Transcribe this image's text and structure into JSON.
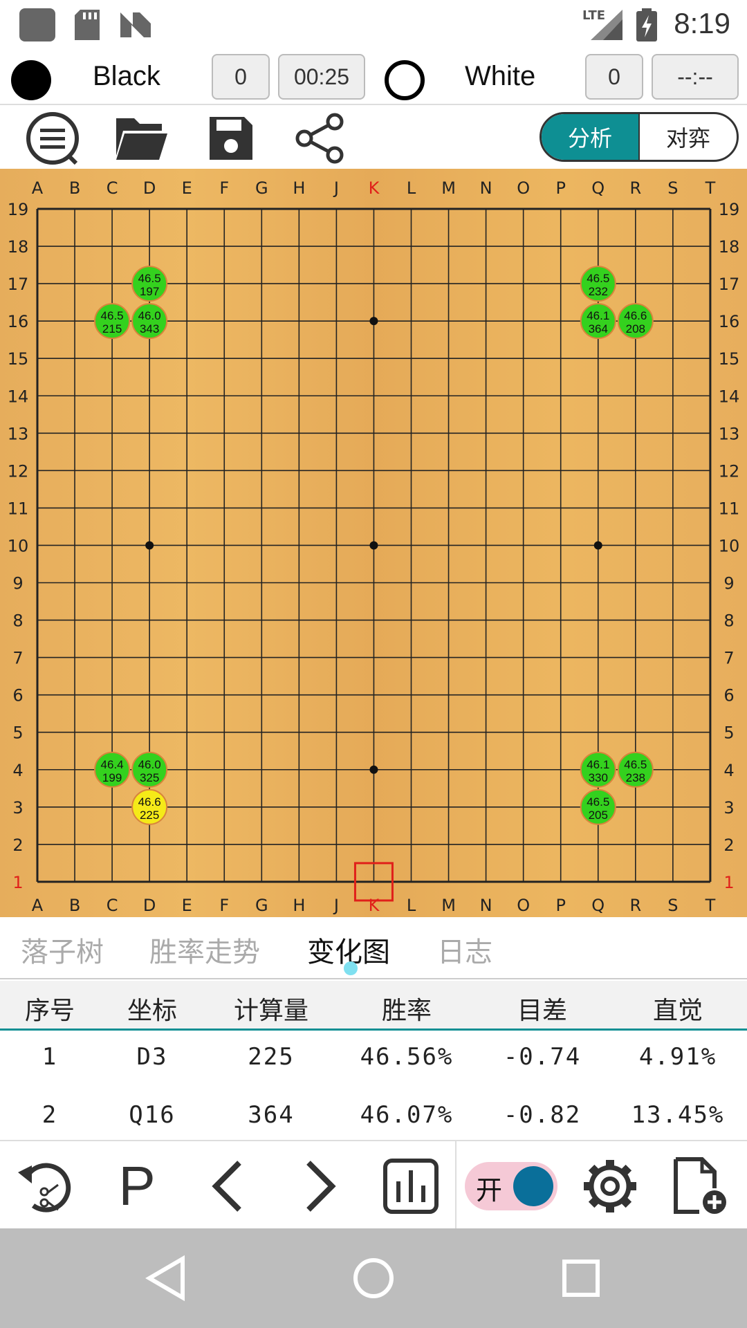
{
  "status_bar": {
    "time": "8:19",
    "network": "LTE",
    "icons": [
      "app-icon",
      "sdcard-icon",
      "n-icon",
      "signal-icon",
      "battery-charging-icon"
    ]
  },
  "players": {
    "black": {
      "name": "Black",
      "captures": "0",
      "time": "00:25"
    },
    "white": {
      "name": "White",
      "captures": "0",
      "time": "--:--"
    }
  },
  "toolbar": {
    "icons": [
      "menu-icon",
      "folder-open-icon",
      "save-icon",
      "share-icon"
    ],
    "mode_analyze": "分析",
    "mode_play": "对弈",
    "active_mode": "analyze"
  },
  "board": {
    "columns": [
      "A",
      "B",
      "C",
      "D",
      "E",
      "F",
      "G",
      "H",
      "J",
      "K",
      "L",
      "M",
      "N",
      "O",
      "P",
      "Q",
      "R",
      "S",
      "T"
    ],
    "rows": [
      "19",
      "18",
      "17",
      "16",
      "15",
      "14",
      "13",
      "12",
      "11",
      "10",
      "9",
      "8",
      "7",
      "6",
      "5",
      "4",
      "3",
      "2",
      "1"
    ],
    "highlight_column": "K",
    "highlight_row": "1",
    "last_move_marker": "K1",
    "highlight_color": "#e0201a",
    "star_points": [
      "D16",
      "K16",
      "Q16",
      "D10",
      "K10",
      "Q10",
      "D4",
      "K4",
      "Q4"
    ],
    "candidates": [
      {
        "coord": "D17",
        "winrate": "46.5",
        "visits": "197",
        "best": false
      },
      {
        "coord": "C16",
        "winrate": "46.5",
        "visits": "215",
        "best": false
      },
      {
        "coord": "D16",
        "winrate": "46.0",
        "visits": "343",
        "best": false
      },
      {
        "coord": "Q17",
        "winrate": "46.5",
        "visits": "232",
        "best": false
      },
      {
        "coord": "Q16",
        "winrate": "46.1",
        "visits": "364",
        "best": false
      },
      {
        "coord": "R16",
        "winrate": "46.6",
        "visits": "208",
        "best": false
      },
      {
        "coord": "C4",
        "winrate": "46.4",
        "visits": "199",
        "best": false
      },
      {
        "coord": "D4",
        "winrate": "46.0",
        "visits": "325",
        "best": false
      },
      {
        "coord": "D3",
        "winrate": "46.6",
        "visits": "225",
        "best": true
      },
      {
        "coord": "Q4",
        "winrate": "46.1",
        "visits": "330",
        "best": false
      },
      {
        "coord": "R4",
        "winrate": "46.5",
        "visits": "238",
        "best": false
      },
      {
        "coord": "Q3",
        "winrate": "46.5",
        "visits": "205",
        "best": false
      }
    ]
  },
  "tabs": [
    {
      "label": "落子树",
      "active": false
    },
    {
      "label": "胜率走势",
      "active": false
    },
    {
      "label": "变化图",
      "active": true
    },
    {
      "label": "日志",
      "active": false
    }
  ],
  "table": {
    "headers": [
      "序号",
      "坐标",
      "计算量",
      "胜率",
      "目差",
      "直觉"
    ],
    "rows": [
      [
        "1",
        "D3",
        "225",
        "46.56%",
        "-0.74",
        "4.91%"
      ],
      [
        "2",
        "Q16",
        "364",
        "46.07%",
        "-0.82",
        "13.45%"
      ]
    ]
  },
  "action_bar": {
    "icons": [
      "undo-cut-icon",
      "pass-icon",
      "previous-icon",
      "next-icon",
      "chart-icon",
      "settings-icon",
      "new-file-icon"
    ],
    "pass_label": "P",
    "switch_label": "开",
    "switch_on": true
  },
  "nav_bar": {
    "icons": [
      "back-icon",
      "home-icon",
      "recents-icon"
    ]
  }
}
